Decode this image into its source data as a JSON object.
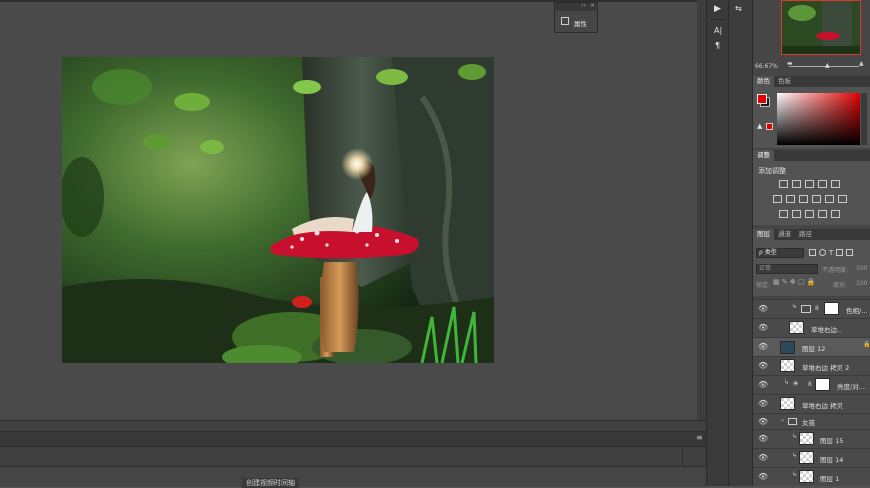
{
  "properties_panel": {
    "title": "属性"
  },
  "tools": {
    "a_label": "A|",
    "para_label": "¶"
  },
  "navigator": {
    "zoom": "66.67%"
  },
  "color_panel": {
    "tabs": [
      "颜色",
      "色板"
    ],
    "fg_color": "#e30000",
    "bg_color": "#1a1a1a"
  },
  "adjustments_panel": {
    "tab": "调整",
    "add_label": "添加调整"
  },
  "layers_panel": {
    "tabs": [
      "图层",
      "通道",
      "路径"
    ],
    "filter_kind": "ρ 类型",
    "blend_mode": "正常",
    "opacity_label": "不透明度:",
    "opacity_value": "100",
    "lock_label": "锁定:",
    "fill_label": "填充:",
    "fill_value": "100",
    "layers": [
      {
        "name": "色相/...",
        "type": "adjustment-clip"
      },
      {
        "name": "草堆右边..",
        "type": "smart"
      },
      {
        "name": "图层 12",
        "type": "pixel-selected"
      },
      {
        "name": "草堆右边 拷贝 2",
        "type": "smart"
      },
      {
        "name": "亮度/对...",
        "type": "adjustment-clip"
      },
      {
        "name": "草堆右边 拷贝",
        "type": "smart"
      },
      {
        "name": "女孩",
        "type": "group"
      },
      {
        "name": "图层 15",
        "type": "clip"
      },
      {
        "name": "图层 14",
        "type": "clip"
      },
      {
        "name": "图层 1",
        "type": "clip"
      }
    ]
  },
  "timeline": {
    "button_label": "创建视频时间轴"
  }
}
